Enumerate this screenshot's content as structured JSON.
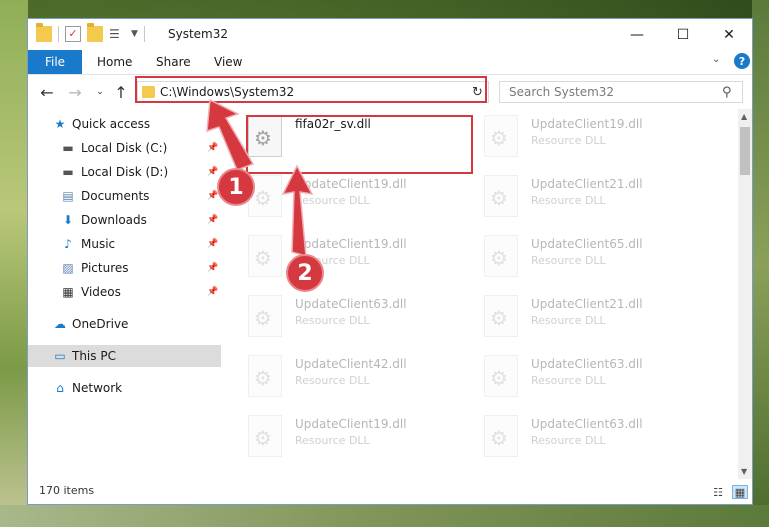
{
  "window": {
    "title": "System32"
  },
  "ribbon": {
    "tabs": [
      "File",
      "Home",
      "Share",
      "View"
    ]
  },
  "address": {
    "path": "C:\\Windows\\System32"
  },
  "search": {
    "placeholder": "Search System32"
  },
  "sidebar": {
    "items": [
      {
        "label": "Quick access",
        "icon": "star-icon"
      },
      {
        "label": "Local Disk (C:)",
        "icon": "drive-icon"
      },
      {
        "label": "Local Disk (D:)",
        "icon": "drive-icon"
      },
      {
        "label": "Documents",
        "icon": "documents-icon"
      },
      {
        "label": "Downloads",
        "icon": "download-icon"
      },
      {
        "label": "Music",
        "icon": "music-icon"
      },
      {
        "label": "Pictures",
        "icon": "pictures-icon"
      },
      {
        "label": "Videos",
        "icon": "videos-icon"
      },
      {
        "label": "OneDrive",
        "icon": "cloud-icon"
      },
      {
        "label": "This PC",
        "icon": "computer-icon"
      },
      {
        "label": "Network",
        "icon": "network-icon"
      }
    ]
  },
  "files": [
    {
      "name": "fifa02r_sv.dll",
      "desc": ""
    },
    {
      "name": "UpdateClient19.dll",
      "desc": "Resource DLL"
    },
    {
      "name": "UpdateClient19.dll",
      "desc": "Resource DLL"
    },
    {
      "name": "UpdateClient21.dll",
      "desc": "Resource DLL"
    },
    {
      "name": "UpdateClient19.dll",
      "desc": "Resource DLL"
    },
    {
      "name": "UpdateClient65.dll",
      "desc": "Resource DLL"
    },
    {
      "name": "UpdateClient63.dll",
      "desc": "Resource DLL"
    },
    {
      "name": "UpdateClient21.dll",
      "desc": "Resource DLL"
    },
    {
      "name": "UpdateClient42.dll",
      "desc": "Resource DLL"
    },
    {
      "name": "UpdateClient63.dll",
      "desc": "Resource DLL"
    },
    {
      "name": "UpdateClient19.dll",
      "desc": "Resource DLL"
    },
    {
      "name": "UpdateClient63.dll",
      "desc": "Resource DLL"
    }
  ],
  "status": {
    "count": "170 items"
  },
  "annotations": {
    "step1": "1",
    "step2": "2",
    "color": "#d6383f"
  }
}
